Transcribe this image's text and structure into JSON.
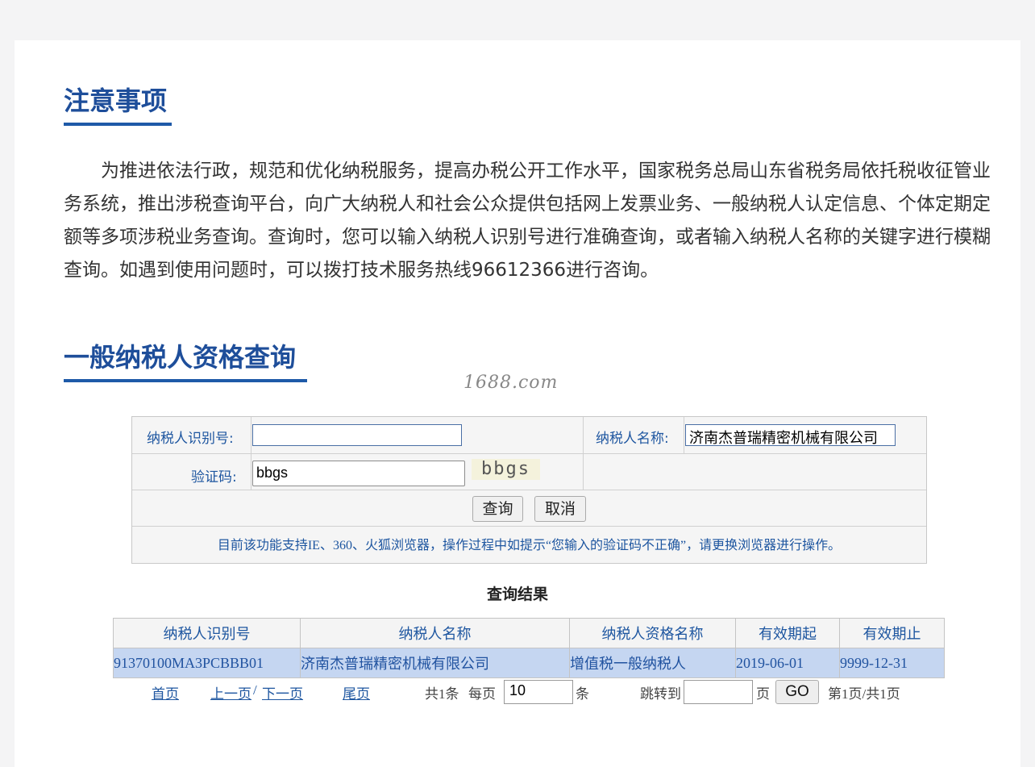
{
  "notice": {
    "title": "注意事项",
    "body": "为推进依法行政，规范和优化纳税服务，提高办税公开工作水平，国家税务总局山东省税务局依托税收征管业务系统，推出涉税查询平台，向广大纳税人和社会公众提供包括网上发票业务、一般纳税人认定信息、个体定期定额等多项涉税业务查询。查询时，您可以输入纳税人识别号进行准确查询，或者输入纳税人名称的关键字进行模糊查询。如遇到使用问题时，可以拨打技术服务热线96612366进行咨询。"
  },
  "query": {
    "title": "一般纳税人资格查询",
    "watermark": "1688.com",
    "taxpayer_id_label": "纳税人识别号:",
    "taxpayer_id_value": "",
    "taxpayer_name_label": "纳税人名称:",
    "taxpayer_name_value": "济南杰普瑞精密机械有限公司",
    "captcha_label": "验证码:",
    "captcha_value": "bbgs",
    "captcha_image_text": "bbgs",
    "submit_label": "查询",
    "cancel_label": "取消",
    "browser_notice": "目前该功能支持IE、360、火狐浏览器，操作过程中如提示“您输入的验证码不正确”，请更换浏览器进行操作。"
  },
  "results": {
    "title": "查询结果",
    "columns": [
      "纳税人识别号",
      "纳税人名称",
      "纳税人资格名称",
      "有效期起",
      "有效期止"
    ],
    "rows": [
      [
        "91370100MA3PCBBB01",
        "济南杰普瑞精密机械有限公司",
        "增值税一般纳税人",
        "2019-06-01",
        "9999-12-31"
      ]
    ]
  },
  "pager": {
    "first": "首页",
    "prev": "上一页",
    "sep": "/",
    "next": "下一页",
    "last": "尾页",
    "total": "共1条",
    "per_page_label": "每页",
    "per_page_value": "10",
    "per_page_unit": "条",
    "jump_label": "跳转到",
    "jump_value": "",
    "page_unit": "页",
    "go_label": "GO",
    "status": "第1页/共1页"
  }
}
